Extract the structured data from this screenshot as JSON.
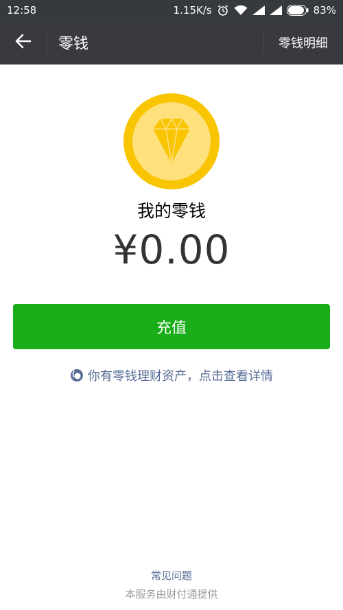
{
  "status_bar": {
    "time": "12:58",
    "network_speed": "1.15K/s",
    "battery": "83%",
    "icons": [
      "alarm-icon",
      "wifi-icon",
      "signal-icon",
      "signal-icon",
      "battery-icon"
    ]
  },
  "nav": {
    "back_icon": "back-arrow-icon",
    "title": "零钱",
    "action_label": "零钱明细"
  },
  "main": {
    "coin_icon": "diamond-coin-icon",
    "balance_label": "我的零钱",
    "balance_amount": "¥0.00",
    "recharge_label": "充值",
    "wealth_link_icon": "licaitong-icon",
    "wealth_link_text": "你有零钱理财资产，点击查看详情"
  },
  "footer": {
    "faq_label": "常见问题",
    "provider_text": "本服务由财付通提供"
  },
  "colors": {
    "nav_bg": "#393a3f",
    "status_bg": "#36393d",
    "primary_green": "#1aad19",
    "link_blue": "#576b95",
    "coin_gold": "#f9c400"
  }
}
